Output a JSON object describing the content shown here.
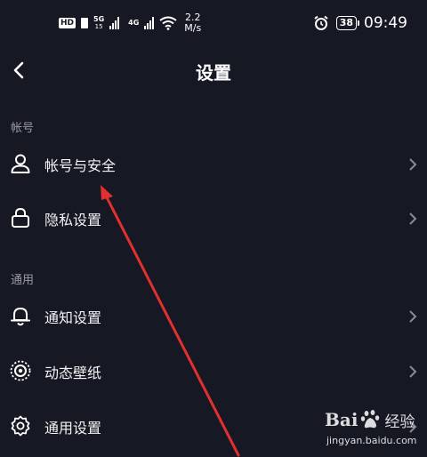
{
  "status_bar": {
    "hd_label": "HD",
    "net1_label": "5G",
    "net1_sub": "15",
    "net2_label": "4G",
    "speed_value": "2.2",
    "speed_unit": "M/s",
    "battery": "38",
    "time": "09:49"
  },
  "nav": {
    "title": "设置"
  },
  "sections": [
    {
      "header": "帐号",
      "items": [
        {
          "label": "帐号与安全",
          "icon": "person-icon"
        },
        {
          "label": "隐私设置",
          "icon": "lock-icon"
        }
      ]
    },
    {
      "header": "通用",
      "items": [
        {
          "label": "通知设置",
          "icon": "bell-icon"
        },
        {
          "label": "动态壁纸",
          "icon": "wallpaper-icon"
        },
        {
          "label": "通用设置",
          "icon": "gear-icon"
        }
      ]
    }
  ],
  "watermark": {
    "brand_left": "Bai",
    "brand_right": "经验",
    "url": "jingyan.baidu.com"
  },
  "colors": {
    "background": "#161823",
    "annotation_arrow": "#e0312f",
    "text": "#f2f2f4",
    "section_text": "#9a9ba6"
  }
}
